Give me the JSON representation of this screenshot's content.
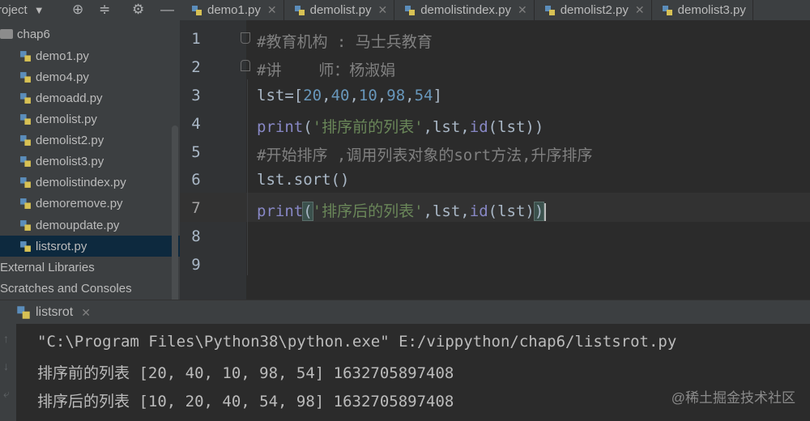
{
  "project_header": {
    "title": "roject"
  },
  "tabs": [
    {
      "label": "demo1.py"
    },
    {
      "label": "demolist.py"
    },
    {
      "label": "demolistindex.py"
    },
    {
      "label": "demolist2.py"
    },
    {
      "label": "demolist3.py"
    }
  ],
  "project_tree": {
    "folder": "chap6",
    "files": [
      "demo1.py",
      "demo4.py",
      "demoadd.py",
      "demolist.py",
      "demolist2.py",
      "demolist3.py",
      "demolistindex.py",
      "demoremove.py",
      "demoupdate.py",
      "listsrot.py"
    ],
    "selected_file": "listsrot.py",
    "external": "External Libraries",
    "scratches": "Scratches and Consoles"
  },
  "editor": {
    "line_numbers": [
      "1",
      "2",
      "3",
      "4",
      "5",
      "6",
      "7",
      "8",
      "9"
    ],
    "current_line": "7",
    "lines": {
      "l1": "#教育机构 : 马士兵教育",
      "l2": "#讲    师：杨淑娟",
      "l3_var": "lst",
      "l3_open": "=[",
      "l3_n1": "20",
      "l3_n2": "40",
      "l3_n3": "10",
      "l3_n4": "98",
      "l3_n5": "54",
      "l3_close": "]",
      "l4_fn": "print",
      "l4_str": "'排序前的列表'",
      "l4_mid": ",lst,",
      "l4_id": "id",
      "l4_end": "(lst))",
      "l5": "#开始排序 ,调用列表对象的sort方法,升序排序",
      "l6_a": "lst.",
      "l6_fn": "sort",
      "l6_b": "()",
      "l7_fn": "print",
      "l7_str": "'排序后的列表'",
      "l7_mid": ",lst,",
      "l7_id": "id",
      "l7_end": "(lst)"
    }
  },
  "run_panel": {
    "tab_label": "listsrot",
    "output": [
      "\"C:\\Program Files\\Python38\\python.exe\" E:/vippython/chap6/listsrot.py",
      "排序前的列表 [20, 40, 10, 98, 54] 1632705897408",
      "排序后的列表 [10, 20, 40, 54, 98] 1632705897408"
    ]
  },
  "watermark": "@稀土掘金技术社区",
  "colors": {
    "accent_selection": "#0d293e",
    "comment": "#808080",
    "number": "#6897bb",
    "string": "#6a8759",
    "builtin": "#8888c6"
  },
  "icons": [
    "gear-icon",
    "target-icon",
    "collapse-icon",
    "minus-icon",
    "python-file-icon",
    "folder-icon",
    "close-icon",
    "arrow-up-icon",
    "arrow-down-icon"
  ]
}
